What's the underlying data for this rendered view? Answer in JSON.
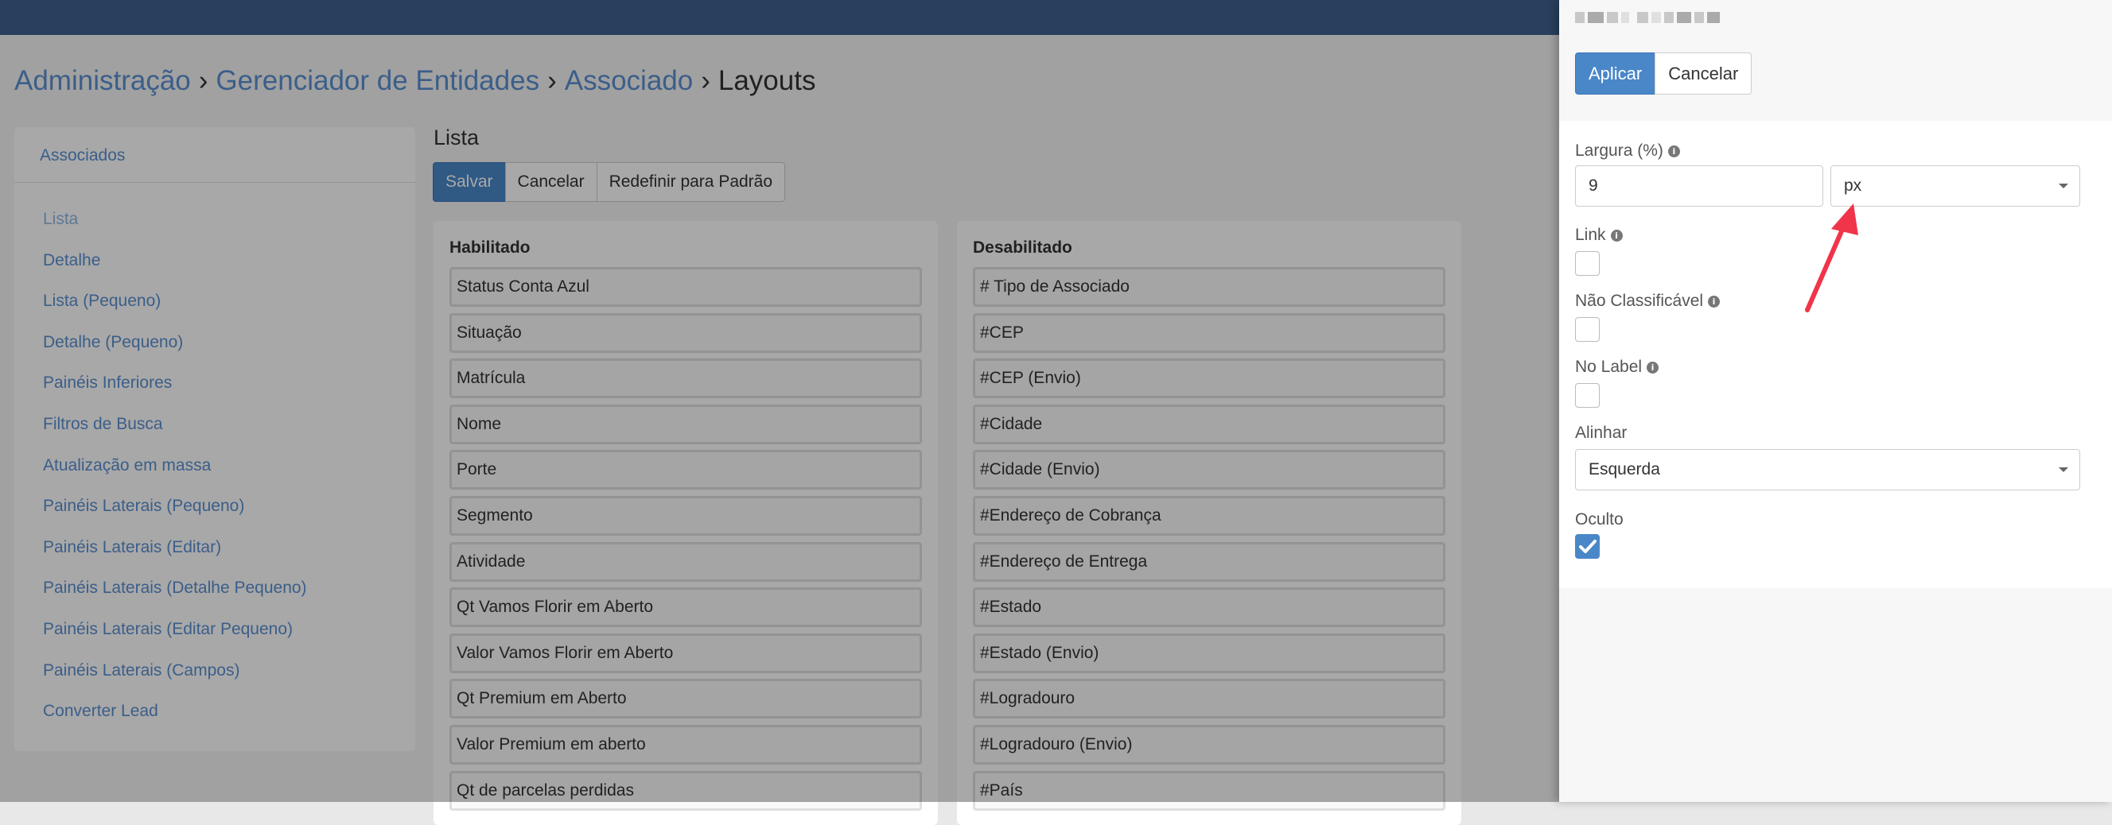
{
  "breadcrumb": {
    "items": [
      "Administração",
      "Gerenciador de Entidades",
      "Associado",
      "Layouts"
    ],
    "separator": "›"
  },
  "sidebar": {
    "title": "Associados",
    "items": [
      {
        "label": "Lista",
        "active": true
      },
      {
        "label": "Detalhe"
      },
      {
        "label": "Lista (Pequeno)"
      },
      {
        "label": "Detalhe (Pequeno)"
      },
      {
        "label": "Painéis Inferiores"
      },
      {
        "label": "Filtros de Busca"
      },
      {
        "label": "Atualização em massa"
      },
      {
        "label": "Painéis Laterais (Pequeno)"
      },
      {
        "label": "Painéis Laterais (Editar)"
      },
      {
        "label": "Painéis Laterais (Detalhe Pequeno)"
      },
      {
        "label": "Painéis Laterais (Editar Pequeno)"
      },
      {
        "label": "Painéis Laterais (Campos)"
      },
      {
        "label": "Converter Lead"
      }
    ]
  },
  "main": {
    "title": "Lista",
    "buttons": {
      "save": "Salvar",
      "cancel": "Cancelar",
      "reset": "Redefinir para Padrão"
    },
    "enabled": {
      "title": "Habilitado",
      "fields": [
        "Status Conta Azul",
        "Situação",
        "Matrícula",
        "Nome",
        "Porte",
        "Segmento",
        "Atividade",
        "Qt Vamos Florir em Aberto",
        "Valor Vamos Florir em Aberto",
        "Qt Premium em Aberto",
        "Valor Premium em aberto",
        "Qt de parcelas perdidas"
      ]
    },
    "disabled": {
      "title": "Desabilitado",
      "fields": [
        "# Tipo de Associado",
        "#CEP",
        "#CEP (Envio)",
        "#Cidade",
        "#Cidade (Envio)",
        "#Endereço de Cobrança",
        "#Endereço de Entrega",
        "#Estado",
        "#Estado (Envio)",
        "#Logradouro",
        "#Logradouro (Envio)",
        "#País"
      ]
    }
  },
  "modal": {
    "buttons": {
      "apply": "Aplicar",
      "cancel": "Cancelar"
    },
    "width": {
      "label": "Largura (%)",
      "value": "9",
      "unit": "px"
    },
    "link": {
      "label": "Link",
      "checked": false
    },
    "not_sortable": {
      "label": "Não Classificável",
      "checked": false
    },
    "no_label": {
      "label": "No Label",
      "checked": false
    },
    "align": {
      "label": "Alinhar",
      "value": "Esquerda"
    },
    "hidden": {
      "label": "Oculto",
      "checked": true
    }
  },
  "colors": {
    "primary": "#4a87c8",
    "link": "#5a8fd0",
    "topbar": "#3e628f",
    "annotation_arrow": "#f0344a"
  },
  "icons": {
    "info": "info-icon",
    "caret": "chevron-down-icon",
    "check": "check-icon",
    "annotation": "arrow-annotation-icon"
  }
}
